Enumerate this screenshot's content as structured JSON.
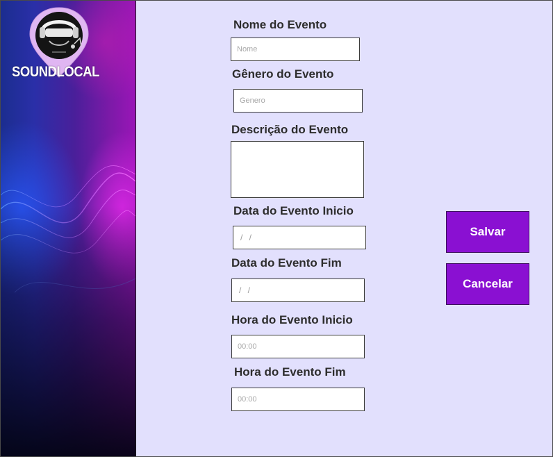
{
  "app": {
    "title": "SOUNDLOCAL",
    "logo_icon": "headphones-music-pin-icon"
  },
  "form": {
    "nome": {
      "label": "Nome do Evento",
      "placeholder": "Nome",
      "value": ""
    },
    "genero": {
      "label": "Gênero do Evento",
      "placeholder": "Genero",
      "value": ""
    },
    "descricao": {
      "label": "Descrição do Evento",
      "value": ""
    },
    "data_inicio": {
      "label": "Data do Evento Inicio",
      "mask": " /  /"
    },
    "data_fim": {
      "label": "Data do Evento Fim",
      "mask": " /  /"
    },
    "hora_inicio": {
      "label": "Hora do Evento Inicio",
      "placeholder": "00:00"
    },
    "hora_fim": {
      "label": "Hora do Evento Fim",
      "placeholder": "00:00"
    }
  },
  "actions": {
    "save_label": "Salvar",
    "cancel_label": "Cancelar"
  },
  "colors": {
    "background": "#e2e0fd",
    "button": "#8a10d2",
    "label": "#2d2d2d"
  }
}
